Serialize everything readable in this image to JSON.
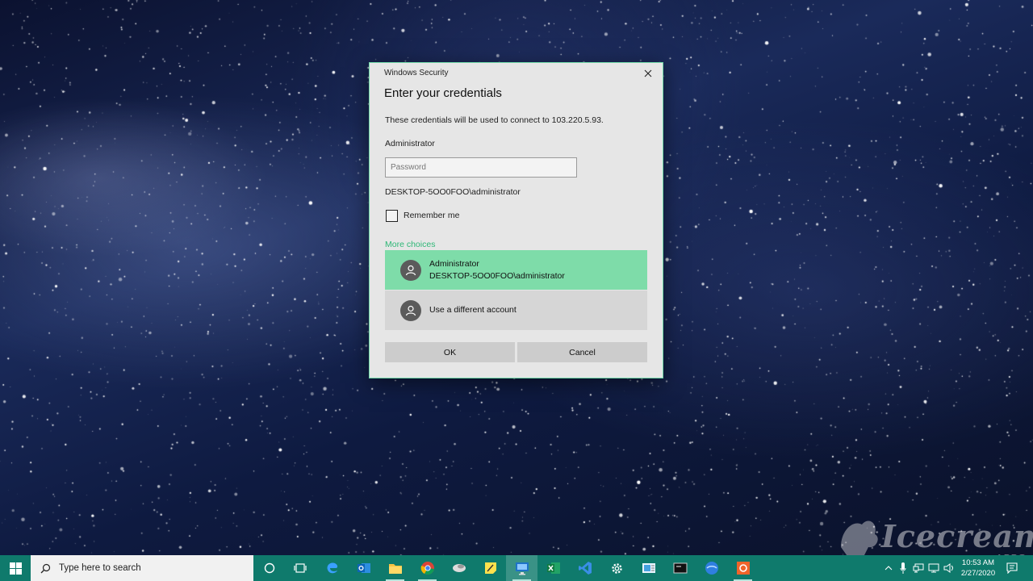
{
  "dialog": {
    "window_title": "Windows Security",
    "heading": "Enter your credentials",
    "description": "These credentials will be used to connect to 103.220.5.93.",
    "username": "Administrator",
    "password_placeholder": "Password",
    "password_value": "",
    "domain_user": "DESKTOP-5OO0FOO\\administrator",
    "remember_label": "Remember me",
    "remember_checked": false,
    "more_choices_label": "More choices",
    "accounts": [
      {
        "name": "Administrator",
        "detail": "DESKTOP-5OO0FOO\\administrator",
        "selected": true
      },
      {
        "name": "Use a different account",
        "detail": "",
        "selected": false
      }
    ],
    "ok_label": "OK",
    "cancel_label": "Cancel",
    "accent_color": "#2fb777",
    "selected_color": "#7edca9"
  },
  "watermark": {
    "text": "Icecream",
    "sub": "APPS"
  },
  "taskbar": {
    "search_placeholder": "Type here to search",
    "color": "#0f7a6c",
    "pinned": [
      "cortana-icon",
      "task-view-icon",
      "edge-icon",
      "outlook-icon",
      "file-explorer-icon",
      "chrome-icon",
      "app-icon",
      "sticky-notes-icon",
      "remote-desktop-icon",
      "excel-icon",
      "visual-studio-icon",
      "settings-icon",
      "mail-icon",
      "terminal-icon",
      "browser-icon",
      "screen-recorder-icon"
    ],
    "clock_time": "10:53 AM",
    "clock_date": "2/27/2020"
  }
}
